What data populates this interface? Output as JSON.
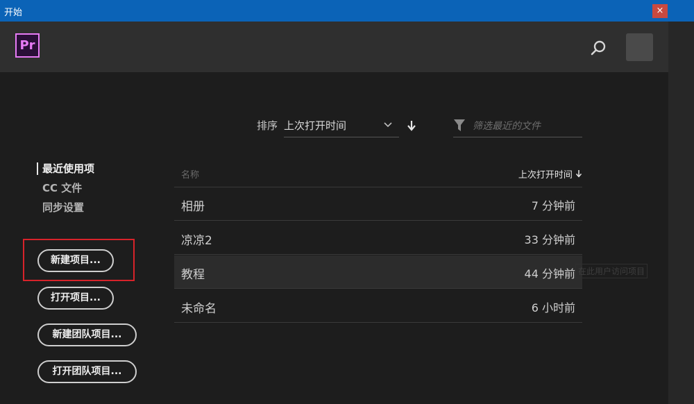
{
  "window": {
    "title": "开始",
    "close_label": "×"
  },
  "header": {
    "logo_text": "Pr"
  },
  "sort": {
    "label": "排序",
    "value": "上次打开时间",
    "direction_icon": "arrow-down-icon"
  },
  "filter": {
    "placeholder": "筛选最近的文件",
    "value": ""
  },
  "sidebar": {
    "items": [
      {
        "label": "最近使用项",
        "active": true
      },
      {
        "label": "CC 文件",
        "active": false
      },
      {
        "label": "同步设置",
        "active": false
      }
    ]
  },
  "actions": {
    "new_project": "新建项目...",
    "open_project": "打开项目...",
    "new_team_project": "新建团队项目...",
    "open_team_project": "打开团队项目..."
  },
  "table": {
    "col_name": "名称",
    "col_time": "上次打开时间",
    "rows": [
      {
        "name": "相册",
        "time": "7 分钟前"
      },
      {
        "name": "凉凉2",
        "time": "33 分钟前"
      },
      {
        "name": "教程",
        "time": "44 分钟前"
      },
      {
        "name": "未命名",
        "time": "6 小时前"
      }
    ]
  },
  "tooltip": {
    "text": "在此用户访问项目"
  },
  "colors": {
    "titlebar": "#0b63b7",
    "accent_premiere": "#e77bf5",
    "highlight_red": "#d8232a"
  }
}
